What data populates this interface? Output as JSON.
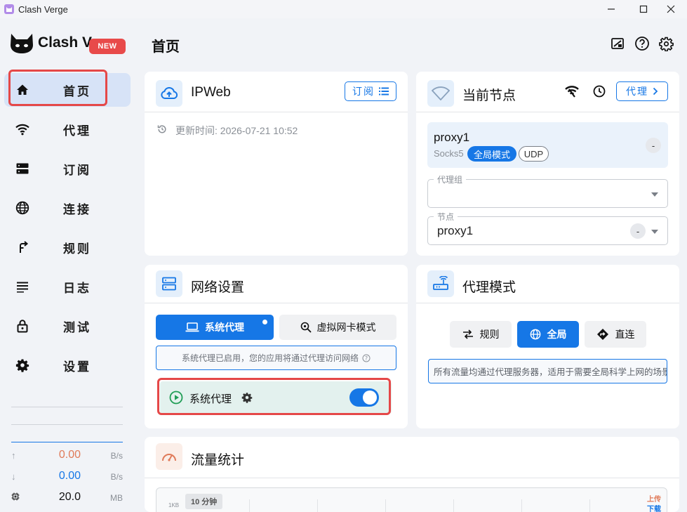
{
  "window": {
    "title": "Clash Verge"
  },
  "sidebar": {
    "logo_text": "Clash Verge",
    "badge": "NEW",
    "items": [
      {
        "label": "首页",
        "icon": "home-icon",
        "active": true
      },
      {
        "label": "代理",
        "icon": "wifi-icon"
      },
      {
        "label": "订阅",
        "icon": "storage-icon"
      },
      {
        "label": "连接",
        "icon": "globe-icon"
      },
      {
        "label": "规则",
        "icon": "fork-arrow-icon"
      },
      {
        "label": "日志",
        "icon": "list-icon"
      },
      {
        "label": "测试",
        "icon": "lock-icon"
      },
      {
        "label": "设置",
        "icon": "gear-icon"
      }
    ],
    "traffic": {
      "up": {
        "value": "0.00",
        "unit": "B/s",
        "color": "#e07b5a"
      },
      "down": {
        "value": "0.00",
        "unit": "B/s",
        "color": "#1677e6"
      },
      "memory": {
        "value": "20.0",
        "unit": "MB"
      }
    }
  },
  "header": {
    "title": "首页"
  },
  "profile_card": {
    "title": "IPWeb",
    "button": "订阅",
    "update_label": "更新时间: 2026-07-21 10:52"
  },
  "node_card": {
    "title": "当前节点",
    "button": "代理",
    "node_name": "proxy1",
    "node_type": "Socks5",
    "mode_chip": "全局模式",
    "udp_chip": "UDP",
    "dash": "-",
    "group_legend": "代理组",
    "group_value": "",
    "node_legend": "节点",
    "node_value": "proxy1"
  },
  "network_card": {
    "title": "网络设置",
    "tab_system": "系统代理",
    "tab_tun": "虚拟网卡模式",
    "info": "系统代理已启用，您的应用将通过代理访问网络",
    "toggle_label": "系统代理",
    "toggle_on": true
  },
  "mode_card": {
    "title": "代理模式",
    "modes": [
      "规则",
      "全局",
      "直连"
    ],
    "selected": "全局",
    "description": "所有流量均通过代理服务器，适用于需要全局科学上网的场景"
  },
  "traffic_card": {
    "title": "流量统计",
    "range": "10 分钟",
    "ytick": "1KB",
    "legend_up": "上传",
    "legend_down": "下载",
    "up_color": "#e07b5a",
    "down_color": "#1677e6"
  },
  "colors": {
    "accent": "#1677e6",
    "active_nav": "#d7e3f7",
    "highlight": "#e54848"
  }
}
